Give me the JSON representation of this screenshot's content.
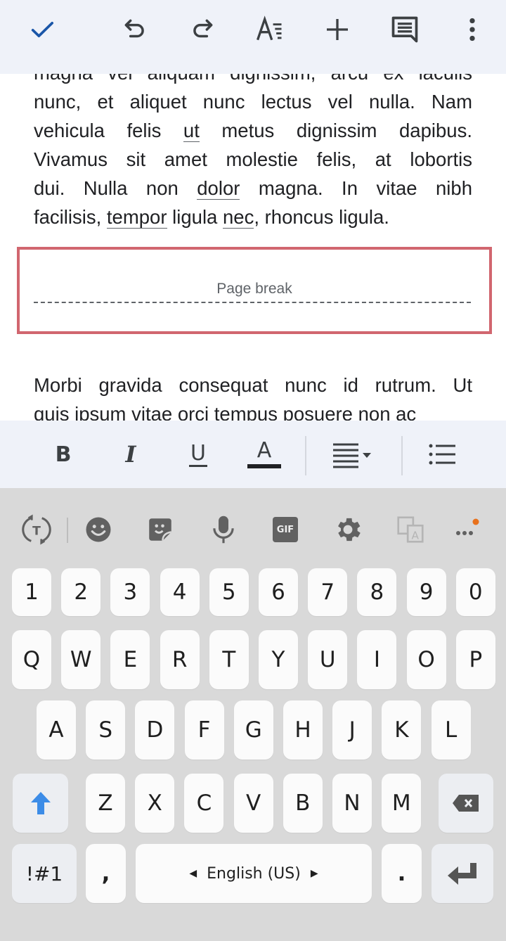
{
  "toolbar": {
    "buttons": [
      {
        "name": "done",
        "icon": "check-icon"
      },
      {
        "name": "undo",
        "icon": "undo-icon"
      },
      {
        "name": "redo",
        "icon": "redo-icon"
      },
      {
        "name": "text-format",
        "icon": "text-format-icon"
      },
      {
        "name": "insert",
        "icon": "plus-icon"
      },
      {
        "name": "comment",
        "icon": "comment-icon"
      },
      {
        "name": "more",
        "icon": "more-vert-icon"
      }
    ],
    "accent_color": "#1a56a8"
  },
  "document": {
    "paragraph1": {
      "lines": [
        [
          "magna vel aliquam dignissim, arcu ex iaculis"
        ],
        [
          "nunc, et aliquet nunc lectus vel nulla. Nam"
        ],
        [
          "vehicula felis ",
          {
            "u": "ut"
          },
          " metus dignissim dapibus."
        ],
        [
          "Vivamus sit amet molestie felis, at lobortis"
        ],
        [
          "dui. Nulla non ",
          {
            "u": "dolor"
          },
          " magna. In vitae nibh"
        ],
        [
          "facilisis, ",
          {
            "u": "tempor"
          },
          " ligula ",
          {
            "u": "nec"
          },
          ", rhoncus ligula."
        ]
      ]
    },
    "page_break_label": "Page break",
    "page_break_highlight_color": "#d1666f",
    "paragraph2": {
      "lines": [
        [
          "Morbi gravida consequat nunc id rutrum. Ut"
        ],
        [
          "quis ipsum vitae orci tempus posuere non ac"
        ]
      ]
    }
  },
  "format_toolbar": {
    "bold_label": "B",
    "italic_label": "I",
    "underline_label": "U",
    "text_color_label": "A",
    "text_color_value": "#202124"
  },
  "keyboard": {
    "toolbar": [
      "translate-toggle-icon",
      "emoji-icon",
      "sticker-icon",
      "microphone-icon",
      "gif-icon",
      "settings-icon",
      "translate-icon",
      "more-icon"
    ],
    "gif_label": "GIF",
    "notification_dot_color": "#e8711c",
    "rows": {
      "numbers": [
        "1",
        "2",
        "3",
        "4",
        "5",
        "6",
        "7",
        "8",
        "9",
        "0"
      ],
      "row1": [
        "Q",
        "W",
        "E",
        "R",
        "T",
        "Y",
        "U",
        "I",
        "O",
        "P"
      ],
      "row2": [
        "A",
        "S",
        "D",
        "F",
        "G",
        "H",
        "J",
        "K",
        "L"
      ],
      "row3": [
        "Z",
        "X",
        "C",
        "V",
        "B",
        "N",
        "M"
      ]
    },
    "symbols_label": "!#1",
    "comma_label": ",",
    "space_label": "English (US)",
    "period_label": ".",
    "shift_color": "#3c8ce7"
  }
}
